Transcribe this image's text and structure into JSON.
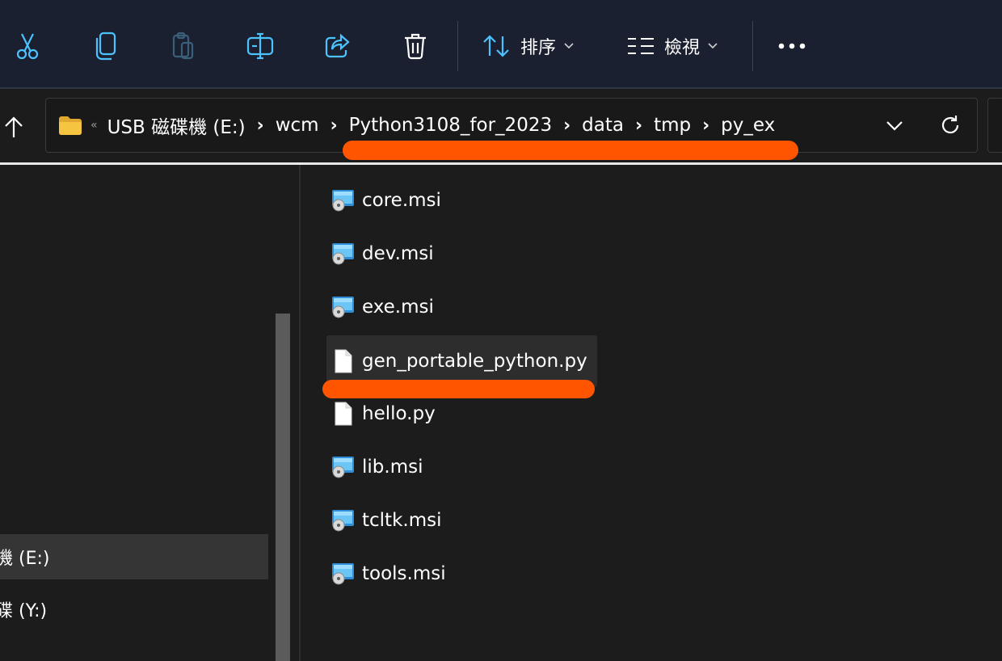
{
  "toolbar": {
    "buttons": [
      {
        "icon": "scissors-icon",
        "action": "cut"
      },
      {
        "icon": "copy-icon",
        "action": "copy"
      },
      {
        "icon": "paste-icon",
        "action": "paste"
      },
      {
        "icon": "rename-icon",
        "action": "rename"
      },
      {
        "icon": "share-icon",
        "action": "share"
      },
      {
        "icon": "trash-icon",
        "action": "delete"
      }
    ],
    "sort_label": "排序",
    "view_label": "檢視",
    "more_icon": "more-dots-icon"
  },
  "address_bar": {
    "overflow_glyph": "«",
    "crumbs": [
      "USB 磁碟機 (E:)",
      "wcm",
      "Python3108_for_2023",
      "data",
      "tmp",
      "py_ex"
    ],
    "separator_glyph": "›"
  },
  "nav_pane": {
    "items": [
      {
        "label": "機 (E:)",
        "selected": true
      },
      {
        "label": "碟 (Y:)",
        "selected": false
      }
    ]
  },
  "files": [
    {
      "name": "core.msi",
      "icon": "msi-installer-icon"
    },
    {
      "name": "dev.msi",
      "icon": "msi-installer-icon"
    },
    {
      "name": "exe.msi",
      "icon": "msi-installer-icon"
    },
    {
      "name": "gen_portable_python.py",
      "icon": "text-file-icon",
      "hovered": true
    },
    {
      "name": "hello.py",
      "icon": "text-file-icon"
    },
    {
      "name": "lib.msi",
      "icon": "msi-installer-icon"
    },
    {
      "name": "tcltk.msi",
      "icon": "msi-installer-icon"
    },
    {
      "name": "tools.msi",
      "icon": "msi-installer-icon"
    }
  ],
  "colors": {
    "toolbar_bg": "#1a2030",
    "content_bg": "#1c1c1c",
    "highlight_mark": "#ff5500",
    "folder_yellow": "#f5c542"
  }
}
